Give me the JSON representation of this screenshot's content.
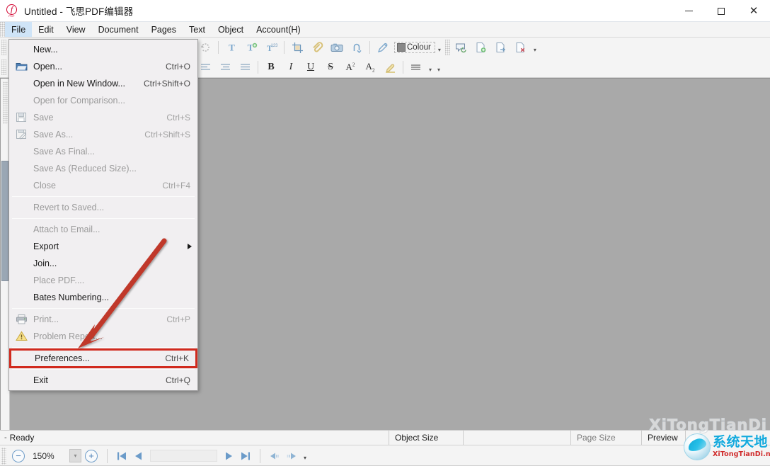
{
  "window": {
    "title": "Untitled - 飞思PDF编辑器",
    "logo_letter": "f",
    "logo_sub": "PDF",
    "minimize_label": "—",
    "maximize_label": "□",
    "close_label": "✕"
  },
  "menubar": {
    "items": [
      {
        "label": "File",
        "active": true
      },
      {
        "label": "Edit",
        "active": false
      },
      {
        "label": "View",
        "active": false
      },
      {
        "label": "Document",
        "active": false
      },
      {
        "label": "Pages",
        "active": false
      },
      {
        "label": "Text",
        "active": false
      },
      {
        "label": "Object",
        "active": false
      },
      {
        "label": "Account(H)",
        "active": false
      }
    ]
  },
  "toolbar": {
    "colour_label": "Colour",
    "colour_swatch": "#888888",
    "row1_icons": [
      "undo-icon",
      "add-text-icon",
      "edit-text-icon",
      "text-order-icon",
      "crop-icon",
      "attachment-icon",
      "camera-icon",
      "link-icon",
      "eyedropper-icon"
    ],
    "row2_icons": [
      "align-left-icon",
      "align-center-icon",
      "align-justify-icon",
      "bold-icon",
      "italic-icon",
      "underline-icon",
      "strikethrough-icon",
      "superscript-icon",
      "subscript-icon",
      "highlighter-icon",
      "line-spacing-icon"
    ],
    "right_icons": [
      "comment-icon",
      "page-add-icon",
      "page-export-icon",
      "page-delete-icon"
    ],
    "bold_label": "B",
    "italic_label": "I",
    "underline_label": "U",
    "strike_label": "S",
    "superscript_label": "A",
    "superscript_sup": "2",
    "subscript_label": "A",
    "subscript_sub": "2"
  },
  "file_menu": {
    "items": [
      {
        "label": "New...",
        "accel": "",
        "enabled": true,
        "icon": "",
        "separator_after": false
      },
      {
        "label": "Open...",
        "accel": "Ctrl+O",
        "enabled": true,
        "icon": "folder-open-icon",
        "separator_after": false
      },
      {
        "label": "Open in New Window...",
        "accel": "Ctrl+Shift+O",
        "enabled": true,
        "icon": "",
        "separator_after": false
      },
      {
        "label": "Open for Comparison...",
        "accel": "",
        "enabled": false,
        "icon": "",
        "separator_after": false
      },
      {
        "label": "Save",
        "accel": "Ctrl+S",
        "enabled": false,
        "icon": "save-icon",
        "separator_after": false
      },
      {
        "label": "Save As...",
        "accel": "Ctrl+Shift+S",
        "enabled": false,
        "icon": "save-as-icon",
        "separator_after": false
      },
      {
        "label": "Save As Final...",
        "accel": "",
        "enabled": false,
        "icon": "",
        "separator_after": false
      },
      {
        "label": "Save As (Reduced Size)...",
        "accel": "",
        "enabled": false,
        "icon": "",
        "separator_after": false
      },
      {
        "label": "Close",
        "accel": "Ctrl+F4",
        "enabled": false,
        "icon": "",
        "separator_after": true
      },
      {
        "label": "Revert to Saved...",
        "accel": "",
        "enabled": false,
        "icon": "",
        "separator_after": true
      },
      {
        "label": "Attach to Email...",
        "accel": "",
        "enabled": false,
        "icon": "",
        "separator_after": false
      },
      {
        "label": "Export",
        "accel": "",
        "enabled": true,
        "icon": "",
        "submenu": true,
        "separator_after": false
      },
      {
        "label": "Join...",
        "accel": "",
        "enabled": true,
        "icon": "",
        "separator_after": false
      },
      {
        "label": "Place PDF....",
        "accel": "",
        "enabled": false,
        "icon": "",
        "separator_after": false
      },
      {
        "label": "Bates Numbering...",
        "accel": "",
        "enabled": true,
        "icon": "",
        "separator_after": true
      },
      {
        "label": "Print...",
        "accel": "Ctrl+P",
        "enabled": false,
        "icon": "printer-icon",
        "separator_after": false
      },
      {
        "label": "Problem Report...",
        "accel": "",
        "enabled": false,
        "icon": "warning-icon",
        "separator_after": true
      },
      {
        "label": "Preferences...",
        "accel": "Ctrl+K",
        "enabled": true,
        "icon": "",
        "highlight": true,
        "separator_after": true
      },
      {
        "label": "Exit",
        "accel": "Ctrl+Q",
        "enabled": true,
        "icon": "",
        "separator_after": false
      }
    ]
  },
  "annotation": {
    "color": "#c0392b",
    "highlight_color": "#d12a1e",
    "target": "Preferences..."
  },
  "statusbar": {
    "dash": "-",
    "ready": "Ready",
    "object_size_label": "Object Size",
    "object_size_value": "",
    "page_size_label": "Page Size",
    "page_size_value": "",
    "preview_label": "Preview"
  },
  "bottombar": {
    "zoom_out_label": "−",
    "zoom_value": "150%",
    "zoom_in_label": "+",
    "page_value": "",
    "first_page_icon": "first-page-icon",
    "prev_page_icon": "prev-page-icon",
    "next_page_icon": "next-page-icon",
    "last_page_icon": "last-page-icon",
    "back_view_icon": "previous-view-icon",
    "forward_view_icon": "next-view-icon"
  },
  "watermark": {
    "cn": "系统天地",
    "en": "XiTongTianDi.net",
    "ghost": "XiTongTianDi"
  }
}
